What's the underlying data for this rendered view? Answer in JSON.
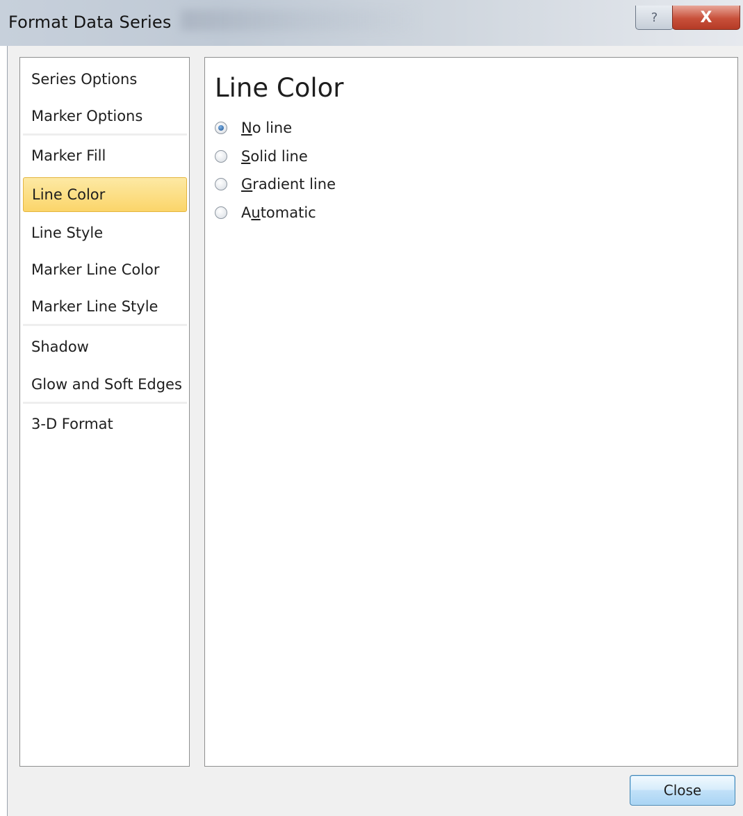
{
  "window": {
    "title": "Format Data Series",
    "help_glyph": "?",
    "close_glyph": "X"
  },
  "sidebar": {
    "items": [
      {
        "label": "Series Options"
      },
      {
        "label": "Marker Options"
      },
      {
        "label": "Marker Fill"
      },
      {
        "label": "Line Color",
        "selected": true
      },
      {
        "label": "Line Style"
      },
      {
        "label": "Marker Line Color"
      },
      {
        "label": "Marker Line Style"
      },
      {
        "label": "Shadow"
      },
      {
        "label": "Glow and Soft Edges"
      },
      {
        "label": "3-D Format"
      }
    ]
  },
  "main": {
    "section_title": "Line Color",
    "options": [
      {
        "accel": "N",
        "rest": "o line",
        "checked": true
      },
      {
        "accel": "S",
        "rest": "olid line",
        "checked": false
      },
      {
        "accel": "G",
        "rest": "radient line",
        "checked": false
      },
      {
        "pre": "A",
        "accel": "u",
        "rest": "tomatic",
        "checked": false
      }
    ]
  },
  "footer": {
    "close_label": "Close"
  },
  "colors": {
    "selected_item_bg": "#fbd56a",
    "selected_item_border": "#e4b53e",
    "close_button_border": "#3c7fb1",
    "title_close_red": "#c8503a"
  }
}
